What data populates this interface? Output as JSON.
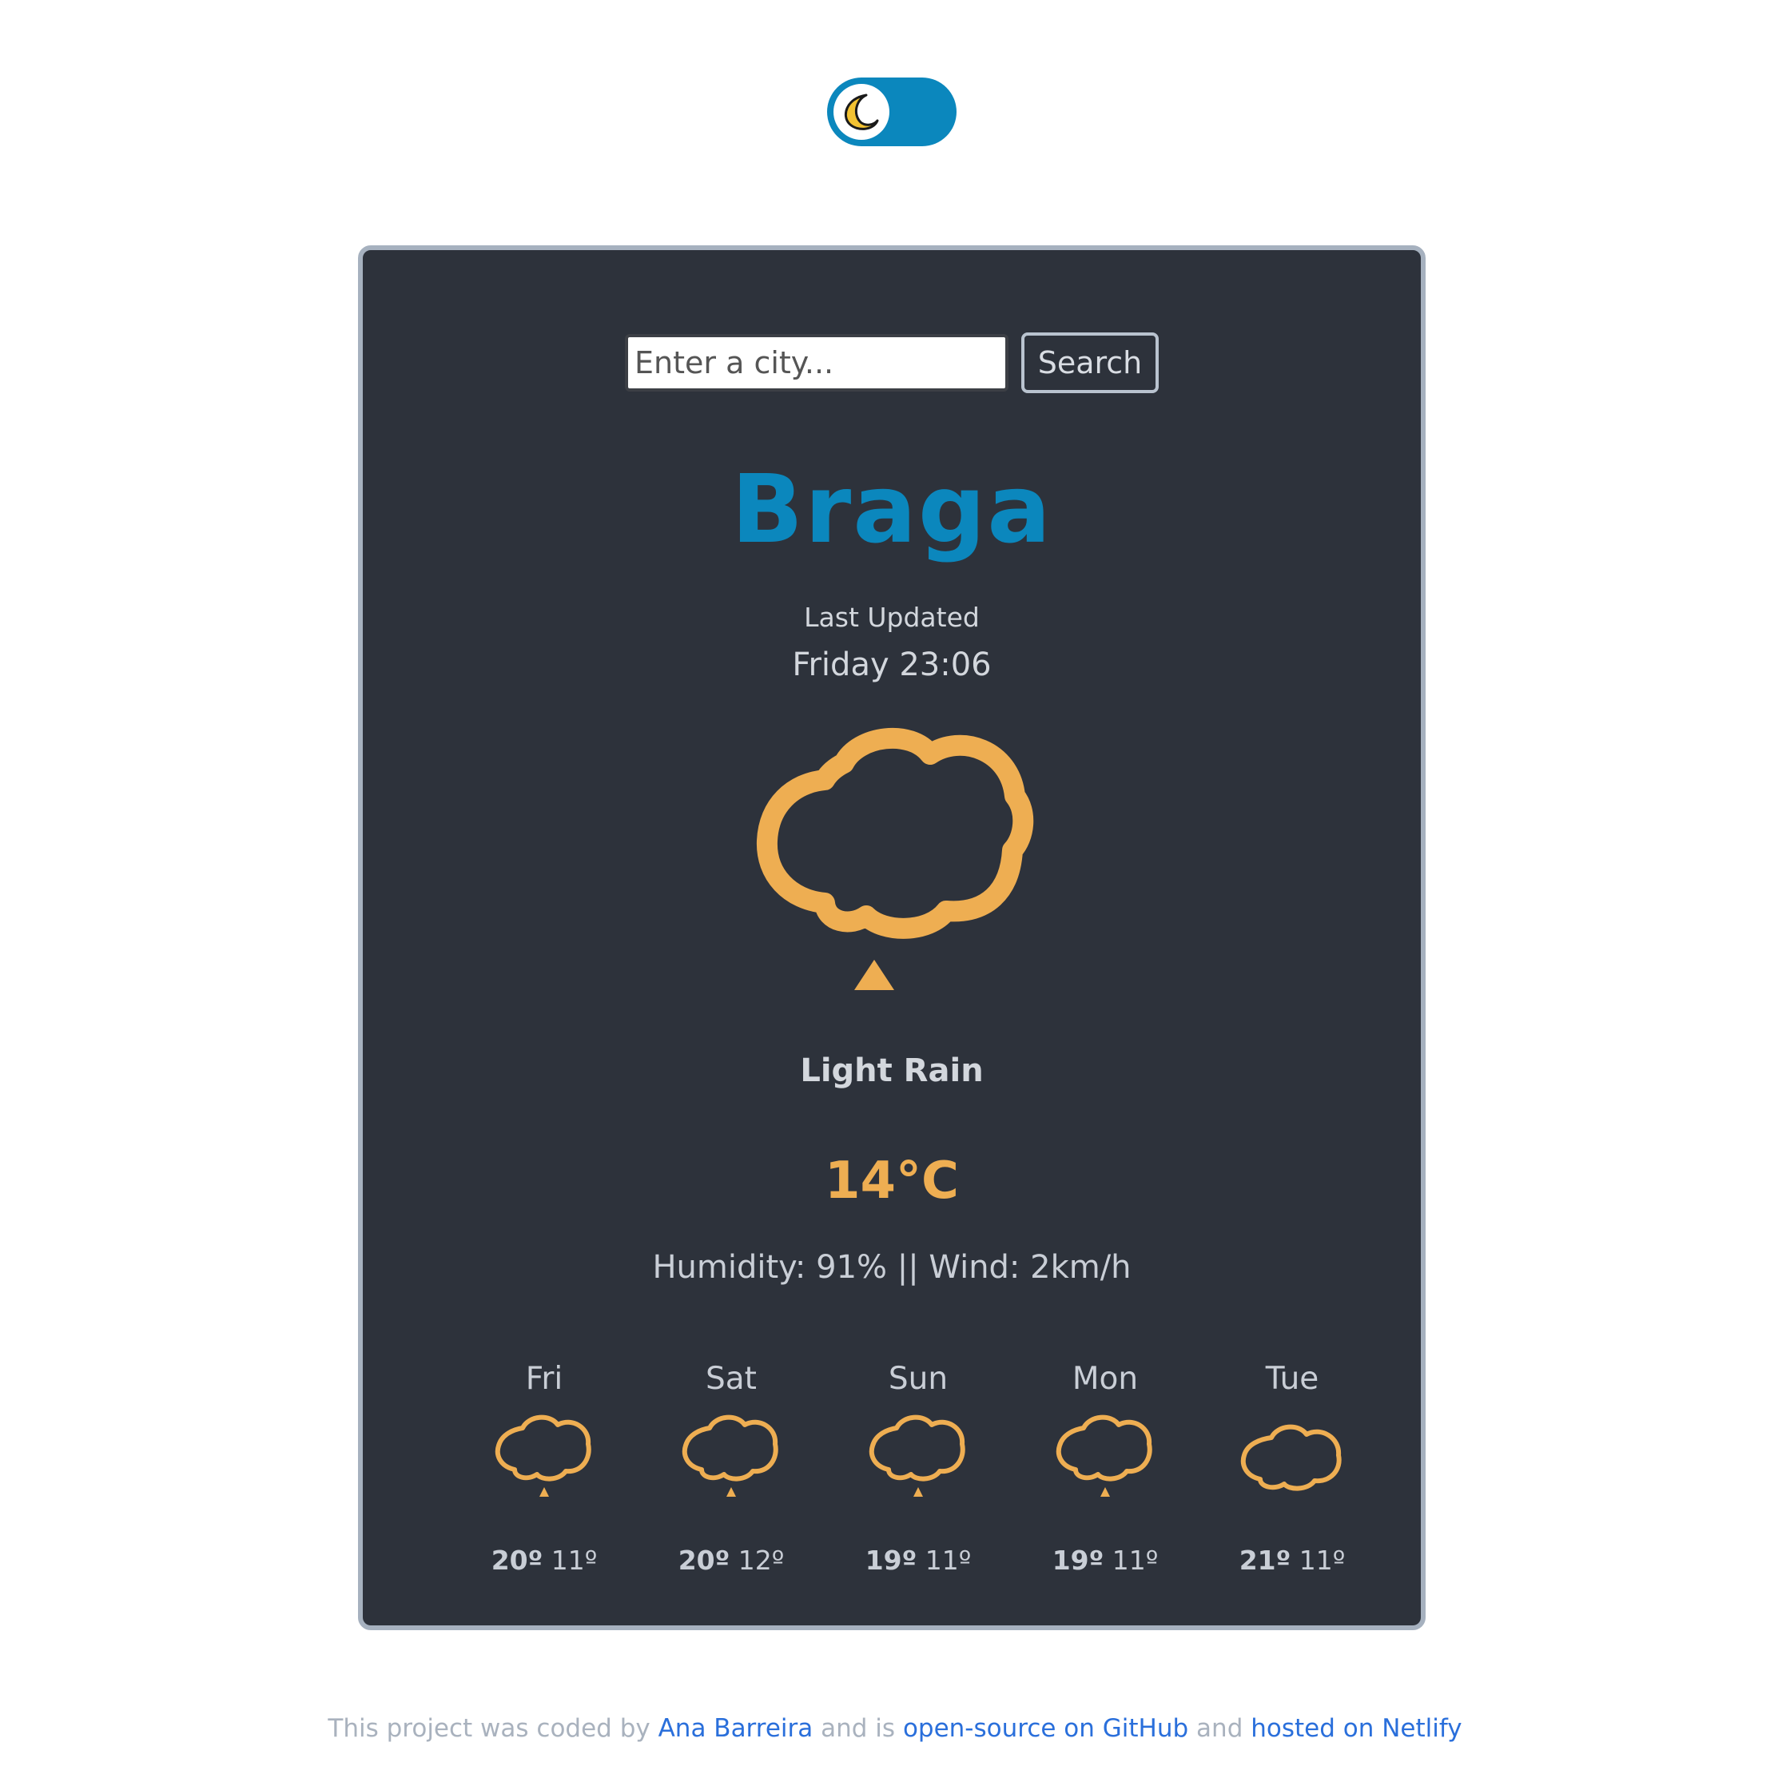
{
  "theme_toggle": {
    "icon": "moon-icon",
    "accent": "#0b87bd"
  },
  "search": {
    "placeholder": "Enter a city...",
    "button_label": "Search"
  },
  "current": {
    "city": "Braga",
    "last_updated_label": "Last Updated",
    "updated_time": "Friday 23:06",
    "icon": "rain-cloud-icon",
    "description": "Light Rain",
    "temperature": "14°C",
    "details": "Humidity: 91% || Wind: 2km/h"
  },
  "forecast": [
    {
      "day": "Fri",
      "max": "20º",
      "min": "11º",
      "icon": "rain-cloud-icon"
    },
    {
      "day": "Sat",
      "max": "20º",
      "min": "12º",
      "icon": "rain-cloud-icon"
    },
    {
      "day": "Sun",
      "max": "19º",
      "min": "11º",
      "icon": "rain-cloud-icon"
    },
    {
      "day": "Mon",
      "max": "19º",
      "min": "11º",
      "icon": "rain-cloud-icon"
    },
    {
      "day": "Tue",
      "max": "21º",
      "min": "11º",
      "icon": "cloud-icon"
    }
  ],
  "footer": {
    "text_1": "This project was coded by",
    "author": "Ana Barreira",
    "text_2": "and is",
    "repo_link": "open-source on GitHub",
    "text_3": "and",
    "host_link": "hosted on Netlify"
  },
  "colors": {
    "card_bg": "#2d323b",
    "card_border": "#a6b1bf",
    "accent_blue": "#0b87bd",
    "icon_orange": "#eeae52",
    "link": "#2a6fdb"
  }
}
